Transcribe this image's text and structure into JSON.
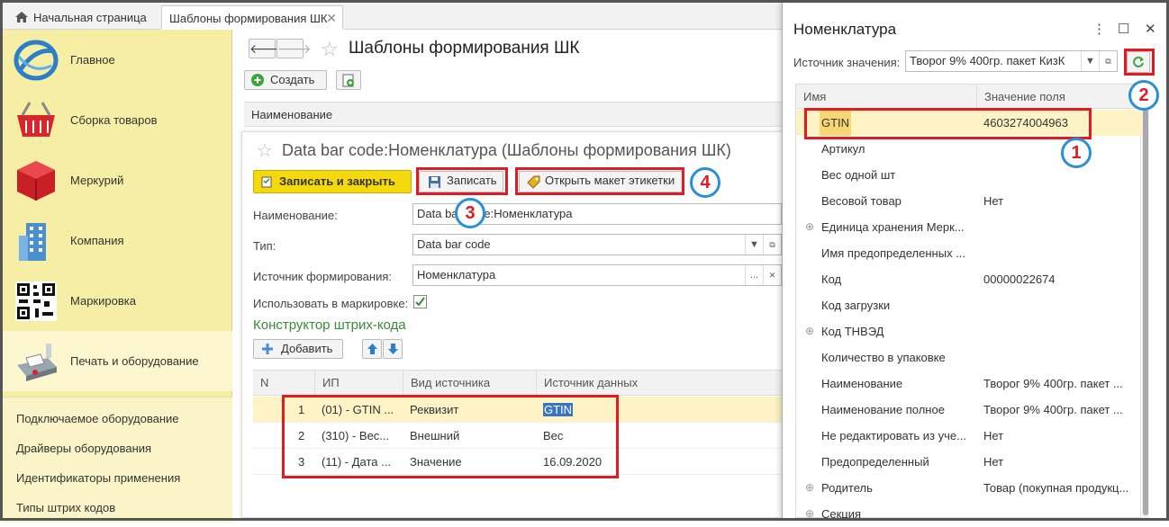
{
  "tabs": {
    "home": "Начальная страница",
    "active": "Шаблоны формирования ШК",
    "close": "✕"
  },
  "sidebar": {
    "items": [
      {
        "label": "Главное",
        "icon": "globe-icon"
      },
      {
        "label": "Сборка товаров",
        "icon": "basket-icon"
      },
      {
        "label": "Меркурий",
        "icon": "cube-icon"
      },
      {
        "label": "Компания",
        "icon": "building-icon"
      },
      {
        "label": "Маркировка",
        "icon": "qr-code-icon"
      },
      {
        "label": "Печать и оборудование",
        "icon": "printer-icon"
      }
    ],
    "links": [
      "Подключаемое оборудование",
      "Драйверы оборудования",
      "Идентификаторы применения",
      "Типы штрих кодов"
    ]
  },
  "main": {
    "back": "🡐",
    "forward": "🡒",
    "title": "Шаблоны формирования ШК",
    "create_label": "Создать",
    "list_header": "Наименование"
  },
  "form": {
    "title": "Data bar code:Номенклатура (Шаблоны формирования ШК)",
    "save_close": "Записать и закрыть",
    "save": "Записать",
    "open_layout": "Открыть макет этикетки",
    "fields": {
      "name_label": "Наименование:",
      "name_value": "Data bar code:Номенклатура",
      "type_label": "Тип:",
      "type_value": "Data bar code",
      "source_label": "Источник формирования:",
      "source_value": "Номенклатура",
      "use_label": "Использовать в маркировке:"
    },
    "constructor_title": "Конструктор штрих-кода",
    "add_label": "Добавить",
    "grid": {
      "headers": [
        "N",
        "ИП",
        "Вид источника",
        "Источник данных"
      ],
      "rows": [
        [
          "1",
          "(01) - GTIN ...",
          "Реквизит",
          "GTIN"
        ],
        [
          "2",
          "(310) - Вес...",
          "Внешний",
          "Вес"
        ],
        [
          "3",
          "(11) - Дата ...",
          "Значение",
          "16.09.2020"
        ]
      ]
    }
  },
  "panel": {
    "title": "Номенклатура",
    "source_label": "Источник значения:",
    "source_value": "Творог 9%  400гр. пакет КизК",
    "menu": "⋮",
    "maximize": "☐",
    "close": "✕",
    "headers": [
      "Имя",
      "Значение поля"
    ],
    "rows": [
      {
        "name": "GTIN",
        "value": "4603274004963",
        "expand": ""
      },
      {
        "name": "Артикул",
        "value": "",
        "expand": ""
      },
      {
        "name": "Вес одной шт",
        "value": "",
        "expand": ""
      },
      {
        "name": "Весовой товар",
        "value": "Нет",
        "expand": ""
      },
      {
        "name": "Единица хранения Мерк...",
        "value": "",
        "expand": "⊕"
      },
      {
        "name": "Имя предопределенных ...",
        "value": "",
        "expand": ""
      },
      {
        "name": "Код",
        "value": "00000022674",
        "expand": ""
      },
      {
        "name": "Код загрузки",
        "value": "",
        "expand": ""
      },
      {
        "name": "Код ТНВЭД",
        "value": "",
        "expand": "⊕"
      },
      {
        "name": "Количество в упаковке",
        "value": "",
        "expand": ""
      },
      {
        "name": "Наименование",
        "value": "Творог 9%  400гр. пакет ...",
        "expand": ""
      },
      {
        "name": "Наименование полное",
        "value": "Творог 9%  400гр. пакет ...",
        "expand": ""
      },
      {
        "name": "Не редактировать из уче...",
        "value": "Нет",
        "expand": ""
      },
      {
        "name": "Предопределенный",
        "value": "Нет",
        "expand": ""
      },
      {
        "name": "Родитель",
        "value": "Товар (покупная продукц...",
        "expand": "⊕"
      },
      {
        "name": "Секция",
        "value": "",
        "expand": "⊕"
      }
    ]
  },
  "annotations": [
    "1",
    "2",
    "3",
    "4"
  ],
  "colors": {
    "accent_red": "#e01b24",
    "callout_blue": "#2b8fd6",
    "sidebar": "#f7eea6",
    "highlight": "#fdf3c4",
    "green": "#3a8a3a"
  }
}
